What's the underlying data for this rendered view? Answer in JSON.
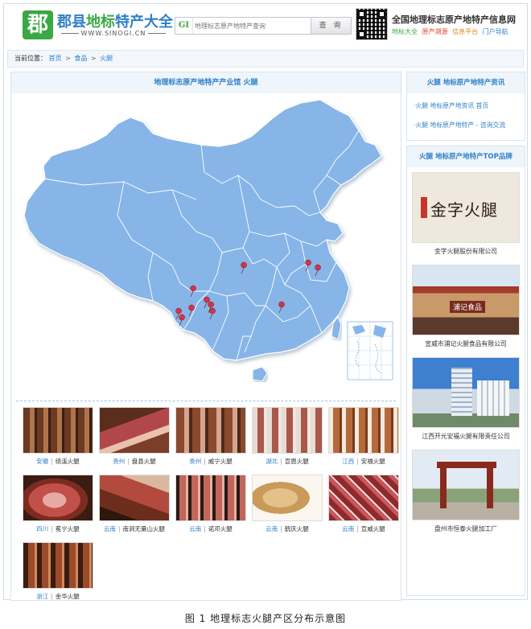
{
  "header": {
    "logo_char": "郡",
    "title_blue": "郡县",
    "title_green": "地标",
    "title_blue2": "特产大全",
    "url": "WWW.SINOGI.CN",
    "search_prefix": "GI",
    "search_placeholder": "地理标志原产地特产查询",
    "search_button": "查 询",
    "network_title": "全国地理标志原产地特产信息网",
    "network_links": [
      {
        "label": "地标大全",
        "color": "#3aa844"
      },
      {
        "label": "原产溯源",
        "color": "#e0462e"
      },
      {
        "label": "信息平台",
        "color": "#e08a1e"
      },
      {
        "label": "门户导航",
        "color": "#2f7fc8"
      }
    ]
  },
  "breadcrumb": {
    "prefix": "当前位置：",
    "items": [
      "首页",
      "食品",
      "火腿"
    ],
    "separator": ">"
  },
  "main": {
    "title": "地理标志原产地特产产业馆  火腿",
    "products": [
      {
        "province": "安徽",
        "name": "绩溪火腿"
      },
      {
        "province": "贵州",
        "name": "盘县火腿"
      },
      {
        "province": "贵州",
        "name": "威宁火腿"
      },
      {
        "province": "湖北",
        "name": "宣恩火腿"
      },
      {
        "province": "江西",
        "name": "安福火腿"
      },
      {
        "province": "四川",
        "name": "冕宁火腿"
      },
      {
        "province": "云南",
        "name": "南涧无量山火腿"
      },
      {
        "province": "云南",
        "name": "诺邓火腿"
      },
      {
        "province": "云南",
        "name": "鹤庆火腿"
      },
      {
        "province": "云南",
        "name": "宣威火腿"
      },
      {
        "province": "浙江",
        "name": "金华火腿"
      }
    ]
  },
  "sidebar": {
    "news_title": "火腿  地标原产地特产资讯",
    "news_items": [
      "·火腿  地标原产地资讯  首页",
      "·火腿  地标原产地特产 - 咨询交流"
    ],
    "brands_title": "火腿  地标原产地特产TOP品牌",
    "brands": [
      {
        "name": "金字火腿股份有限公司",
        "logo_text": "金字火腿"
      },
      {
        "name": "宣威市浦记火腿食品有限公司",
        "logo_text": "浦记食品"
      },
      {
        "name": "江西开元安福火腿有限责任公司",
        "logo_text": ""
      },
      {
        "name": "盘州市恒泰火腿加工厂",
        "logo_text": ""
      }
    ]
  },
  "figure_caption": "图 1  地理标志火腿产区分布示意图",
  "colors": {
    "accent": "#2f7fc8",
    "brand_green": "#3aa844",
    "map_fill": "#87b5e8",
    "marker": "#d2344a"
  }
}
